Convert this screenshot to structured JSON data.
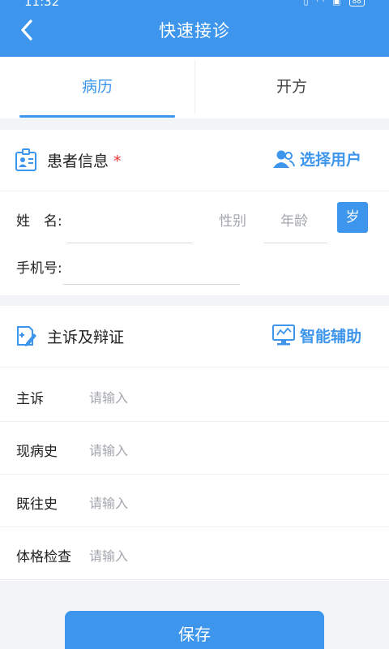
{
  "status_bar": {
    "time": "11:32",
    "battery": "88"
  },
  "header": {
    "title": "快速接诊",
    "back_icon": "chevron-left-icon"
  },
  "tabs": [
    {
      "label": "病历",
      "active": true
    },
    {
      "label": "开方",
      "active": false
    }
  ],
  "patient_section": {
    "title": "患者信息",
    "required_mark": "*",
    "select_user_label": "选择用户",
    "name_label": "姓　名:",
    "gender_placeholder": "性别",
    "age_placeholder": "年龄",
    "age_unit": "岁",
    "phone_label": "手机号:"
  },
  "complaint_section": {
    "title": "主诉及辩证",
    "assist_label": "智能辅助",
    "rows": [
      {
        "label": "主诉",
        "placeholder": "请输入"
      },
      {
        "label": "现病史",
        "placeholder": "请输入"
      },
      {
        "label": "既往史",
        "placeholder": "请输入"
      },
      {
        "label": "体格检查",
        "placeholder": "请输入"
      }
    ]
  },
  "save_button": "保存",
  "colors": {
    "accent": "#3d95ec",
    "required": "#e33333"
  }
}
